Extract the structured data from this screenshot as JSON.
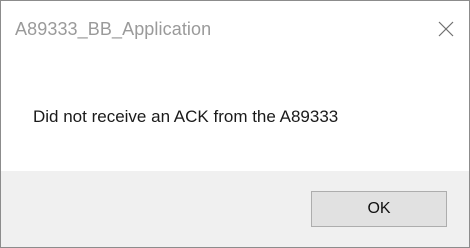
{
  "window": {
    "title": "A89333_BB_Application"
  },
  "message": {
    "text": "Did not receive an ACK from the A89333"
  },
  "buttons": {
    "ok_label": "OK"
  },
  "icons": {
    "close": "close-icon"
  },
  "colors": {
    "title_text": "#9a9a9a",
    "footer_background": "#f0f0f0",
    "button_background": "#e1e1e1",
    "button_border": "#adadad"
  }
}
